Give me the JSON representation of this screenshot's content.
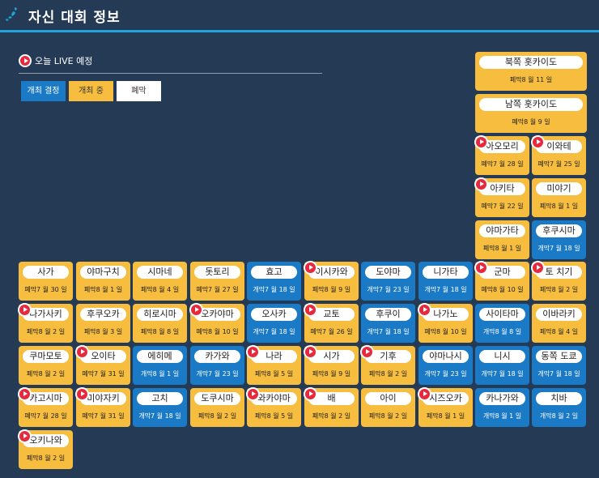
{
  "header": {
    "title": "자신 대회 정보"
  },
  "legend": {
    "live_text": "오늘 LIVE 예정",
    "buttons": {
      "open": "개최 결정",
      "ongoing": "개최 중",
      "closed": "폐막"
    }
  },
  "colors": {
    "ongoing": "#f7bd3f",
    "open": "#1a7ac5",
    "live": "#e8283c",
    "background": "#243a55"
  },
  "prefectures": [
    {
      "name": "북쪽 홋카이도",
      "info": "폐막8 월 11 일",
      "status": "ongoing",
      "live": false
    },
    {
      "name": "남쪽 홋카이도",
      "info": "폐막8 월 9 일",
      "status": "ongoing",
      "live": false
    },
    {
      "name": "아오모리",
      "info": "폐막7 월 28 일",
      "status": "ongoing",
      "live": true
    },
    {
      "name": "이와테",
      "info": "폐막7 월 25 일",
      "status": "ongoing",
      "live": true
    },
    {
      "name": "아키타",
      "info": "폐막7 월 22 일",
      "status": "ongoing",
      "live": true
    },
    {
      "name": "미야기",
      "info": "폐막8 월 1 일",
      "status": "ongoing",
      "live": false
    },
    {
      "name": "야마가타",
      "info": "폐막8 월 1 일",
      "status": "ongoing",
      "live": false
    },
    {
      "name": "후쿠시마",
      "info": "개막7 월 18 일",
      "status": "open",
      "live": false
    },
    {
      "name": "사가",
      "info": "폐막7 월 30 일",
      "status": "ongoing",
      "live": false
    },
    {
      "name": "야마구치",
      "info": "폐막8 월 1 일",
      "status": "ongoing",
      "live": false
    },
    {
      "name": "시마네",
      "info": "폐막8 월 4 일",
      "status": "ongoing",
      "live": false
    },
    {
      "name": "돗토리",
      "info": "폐막7 월 27 일",
      "status": "ongoing",
      "live": false
    },
    {
      "name": "효고",
      "info": "개막7 월 18 일",
      "status": "open",
      "live": false
    },
    {
      "name": "이시카와",
      "info": "폐막8 월 9 일",
      "status": "ongoing",
      "live": true
    },
    {
      "name": "도야마",
      "info": "개막7 월 23 일",
      "status": "open",
      "live": false
    },
    {
      "name": "니가타",
      "info": "개막7 월 18 일",
      "status": "open",
      "live": false
    },
    {
      "name": "군마",
      "info": "폐막8 월 10 일",
      "status": "ongoing",
      "live": true
    },
    {
      "name": "토 치기",
      "info": "폐막8 월 2 일",
      "status": "ongoing",
      "live": true
    },
    {
      "name": "나가사키",
      "info": "폐막8 월 2 일",
      "status": "ongoing",
      "live": true
    },
    {
      "name": "후쿠오카",
      "info": "폐막8 월 3 일",
      "status": "ongoing",
      "live": false
    },
    {
      "name": "히로시마",
      "info": "폐막8 월 8 일",
      "status": "ongoing",
      "live": false
    },
    {
      "name": "오카야마",
      "info": "폐막8 월 10 일",
      "status": "ongoing",
      "live": true
    },
    {
      "name": "오사카",
      "info": "개막7 월 18 일",
      "status": "open",
      "live": false
    },
    {
      "name": "교토",
      "info": "폐막7 월 26 일",
      "status": "ongoing",
      "live": true
    },
    {
      "name": "후쿠이",
      "info": "개막7 월 18 일",
      "status": "open",
      "live": false
    },
    {
      "name": "나가노",
      "info": "폐막8 월 10 일",
      "status": "ongoing",
      "live": true
    },
    {
      "name": "사이타마",
      "info": "개막8 월 8 일",
      "status": "open",
      "live": false
    },
    {
      "name": "이바라키",
      "info": "폐막8 월 4 일",
      "status": "ongoing",
      "live": false
    },
    {
      "name": "쿠마모토",
      "info": "폐막8 월 2 일",
      "status": "ongoing",
      "live": false
    },
    {
      "name": "오이타",
      "info": "폐막7 월 31 일",
      "status": "ongoing",
      "live": true
    },
    {
      "name": "에히메",
      "info": "개막8 월 1 일",
      "status": "open",
      "live": false
    },
    {
      "name": "카가와",
      "info": "개막7 월 23 일",
      "status": "open",
      "live": false
    },
    {
      "name": "나라",
      "info": "폐막8 월 5 일",
      "status": "ongoing",
      "live": true
    },
    {
      "name": "시가",
      "info": "폐막8 월 9 일",
      "status": "ongoing",
      "live": true
    },
    {
      "name": "기후",
      "info": "폐막8 월 2 일",
      "status": "ongoing",
      "live": true
    },
    {
      "name": "야마나시",
      "info": "개막7 월 23 일",
      "status": "open",
      "live": false
    },
    {
      "name": "니시",
      "info": "개막7 월 18 일",
      "status": "open",
      "live": false
    },
    {
      "name": "동쪽 도쿄",
      "info": "개막7 월 18 일",
      "status": "open",
      "live": false
    },
    {
      "name": "카고시마",
      "info": "폐막7 월 28 일",
      "status": "ongoing",
      "live": true
    },
    {
      "name": "미야자키",
      "info": "폐막7 월 31 일",
      "status": "ongoing",
      "live": true
    },
    {
      "name": "고치",
      "info": "개막7 월 18 일",
      "status": "open",
      "live": false
    },
    {
      "name": "도쿠시마",
      "info": "폐막8 월 2 일",
      "status": "ongoing",
      "live": false
    },
    {
      "name": "와카야마",
      "info": "폐막8 월 5 일",
      "status": "ongoing",
      "live": true
    },
    {
      "name": "배",
      "info": "폐막8 월 2 일",
      "status": "ongoing",
      "live": true
    },
    {
      "name": "아이",
      "info": "폐막8 월 2 일",
      "status": "ongoing",
      "live": false
    },
    {
      "name": "시즈오카",
      "info": "폐막8 월 1 일",
      "status": "ongoing",
      "live": true
    },
    {
      "name": "카나가와",
      "info": "개막8 월 1 일",
      "status": "open",
      "live": false
    },
    {
      "name": "치바",
      "info": "개막8 월 2 일",
      "status": "open",
      "live": false
    },
    {
      "name": "오키나와",
      "info": "폐막8 월 2 일",
      "status": "ongoing",
      "live": true
    }
  ]
}
